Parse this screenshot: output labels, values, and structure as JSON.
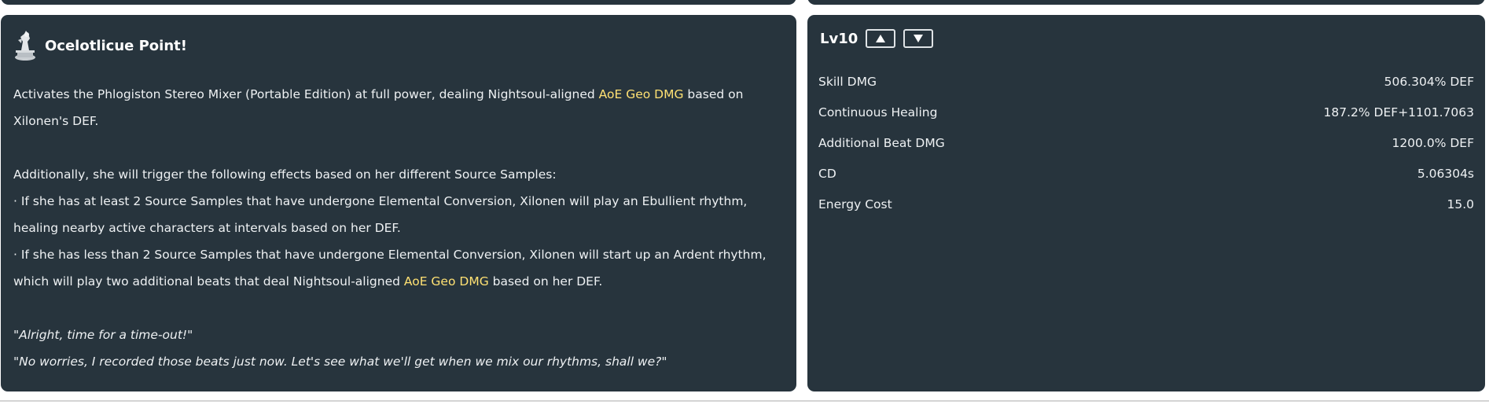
{
  "skill": {
    "title": "Ocelotlicue Point!",
    "icon": "burst-skill-icon",
    "desc": {
      "p1_a": "Activates the Phlogiston Stereo Mixer (Portable Edition) at full power, dealing Nightsoul-aligned ",
      "p1_hl": "AoE Geo DMG",
      "p1_b": " based on Xilonen's DEF.",
      "p2": "Additionally, she will trigger the following effects based on her different Source Samples:",
      "p3": "· If she has at least 2 Source Samples that have undergone Elemental Conversion, Xilonen will play an Ebullient rhythm, healing nearby active characters at intervals based on her DEF.",
      "p4_a": "· If she has less than 2 Source Samples that have undergone Elemental Conversion, Xilonen will start up an Ardent rhythm, which will play two additional beats that deal Nightsoul-aligned ",
      "p4_hl": "AoE Geo DMG",
      "p4_b": " based on her DEF.",
      "q1": "\"Alright, time for a time-out!\"",
      "q2": "\"No worries, I recorded those beats just now. Let's see what we'll get when we mix our rhythms, shall we?\""
    }
  },
  "level": {
    "label": "Lv10",
    "up_icon": "triangle-up-icon",
    "down_icon": "triangle-down-icon"
  },
  "stats": [
    {
      "name": "Skill DMG",
      "value": "506.304% DEF"
    },
    {
      "name": "Continuous Healing",
      "value": "187.2% DEF+1101.7063"
    },
    {
      "name": "Additional Beat DMG",
      "value": "1200.0% DEF"
    },
    {
      "name": "CD",
      "value": "5.06304s"
    },
    {
      "name": "Energy Cost",
      "value": "15.0"
    }
  ],
  "colors": {
    "card_bg": "#27343d",
    "highlight": "#ffe173",
    "text": "#eef1f3"
  }
}
